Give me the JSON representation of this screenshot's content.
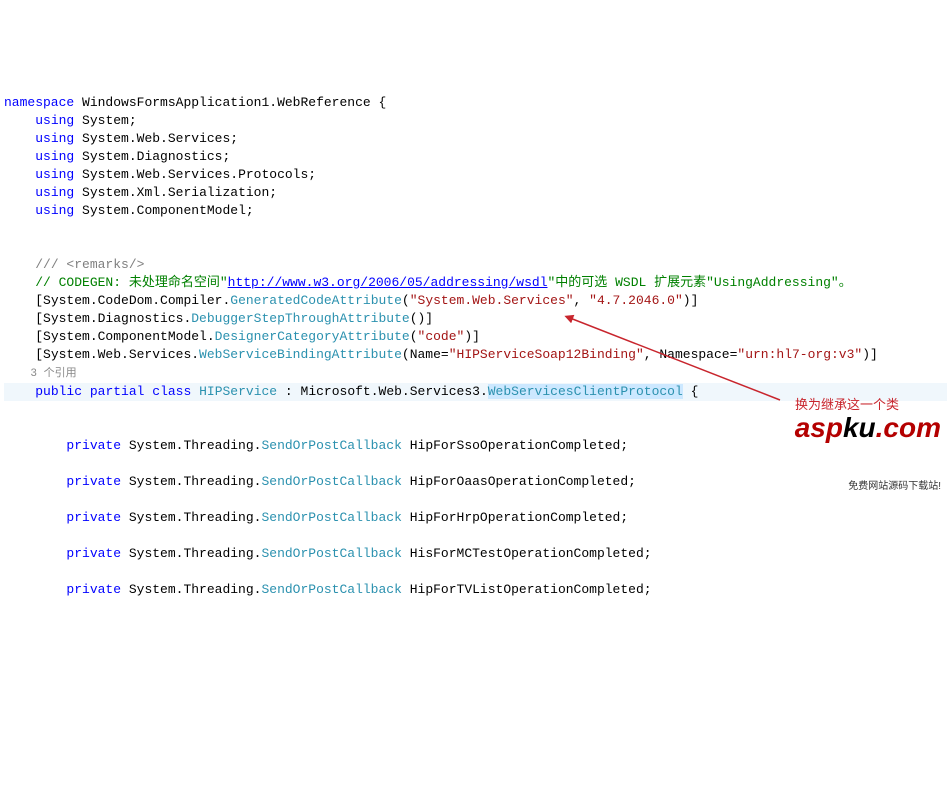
{
  "kw": {
    "namespace": "namespace",
    "using": "using",
    "public": "public",
    "partial": "partial",
    "class": "class",
    "private": "private"
  },
  "ns_name": "WindowsFormsApplication1.WebReference",
  "usings": {
    "u1": "System",
    "u2": "System.Web.Services",
    "u3": "System.Diagnostics",
    "u4": "System.Web.Services.Protocols",
    "u5": "System.Xml.Serialization",
    "u6": "System.ComponentModel"
  },
  "comments": {
    "remarks": "/// <remarks/>",
    "codegen_pre": "// CODEGEN: 未处理命名空间\"",
    "codegen_link": "http://www.w3.org/2006/05/addressing/wsdl",
    "codegen_post": "\"中的可选 WSDL 扩展元素\"UsingAddressing\"。"
  },
  "attrs": {
    "a1_pre": "[System.CodeDom.Compiler.",
    "a1_type": "GeneratedCodeAttribute",
    "a1_arg1": "\"System.Web.Services\"",
    "a1_arg2": "\"4.7.2046.0\"",
    "a2_pre": "[System.Diagnostics.",
    "a2_type": "DebuggerStepThroughAttribute",
    "a3_pre": "[System.ComponentModel.",
    "a3_type": "DesignerCategoryAttribute",
    "a3_arg": "\"code\"",
    "a4_pre": "[System.Web.Services.",
    "a4_type": "WebServiceBindingAttribute",
    "a4_name_lbl": "Name=",
    "a4_name_val": "\"HIPServiceSoap12Binding\"",
    "a4_ns_lbl": "Namespace=",
    "a4_ns_val": "\"urn:hl7-org:v3\""
  },
  "refcount": "3 个引用",
  "classdef": {
    "name": "HIPService",
    "base_pre": " : Microsoft.Web.Services3.",
    "base_type": "WebServicesClientProtocol"
  },
  "fields": {
    "type_pre": "System.Threading.",
    "cb_type": "SendOrPostCallback",
    "f1": "HipForSsoOperationCompleted",
    "f2": "HipForOaasOperationCompleted",
    "f3": "HipForHrpOperationCompleted",
    "f4": "HisForMCTestOperationCompleted",
    "f5": "HipForTVListOperationCompleted"
  },
  "annotation": "换为继承这一个类",
  "watermark": {
    "brand_a": "asp",
    "brand_b": "ku",
    "brand_c": ".com",
    "tagline": "免费网站源码下载站!"
  }
}
